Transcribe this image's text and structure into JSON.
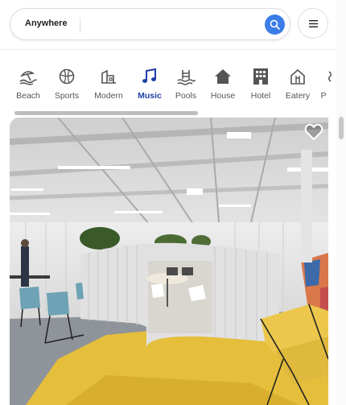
{
  "search": {
    "location_label": "Anywhere"
  },
  "icons": {
    "search": "search-icon",
    "menu": "hamburger-menu-icon",
    "favorite": "heart-icon"
  },
  "categories": [
    {
      "label": "Beach",
      "icon": "beach-icon"
    },
    {
      "label": "Sports",
      "icon": "sports-ball-icon"
    },
    {
      "label": "Modern",
      "icon": "modern-building-icon"
    },
    {
      "label": "Music",
      "icon": "music-note-icon",
      "active": true
    },
    {
      "label": "Pools",
      "icon": "pool-icon"
    },
    {
      "label": "House",
      "icon": "house-icon"
    },
    {
      "label": "Hotel",
      "icon": "hotel-icon"
    },
    {
      "label": "Eatery",
      "icon": "eatery-icon"
    },
    {
      "label": "P",
      "icon": "partial-category-icon"
    }
  ],
  "colors": {
    "accent": "#3b7de8",
    "active_category": "#1f3ea6"
  },
  "listing": {
    "image": "modern office interior with yellow floor"
  }
}
